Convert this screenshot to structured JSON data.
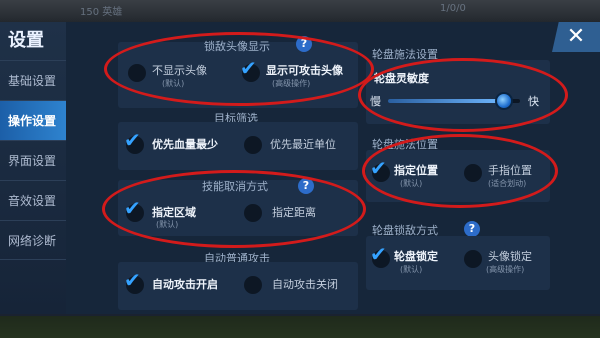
{
  "settings": {
    "title": "设置",
    "nav": [
      {
        "label": "基础设置",
        "active": false
      },
      {
        "label": "操作设置",
        "active": true
      },
      {
        "label": "界面设置",
        "active": false
      },
      {
        "label": "音效设置",
        "active": false
      },
      {
        "label": "网络诊断",
        "active": false
      }
    ],
    "close_icon": "close-icon"
  },
  "left": {
    "enemy_avatar": {
      "title": "锁敌头像显示",
      "opt1": {
        "label": "不显示头像",
        "sub": "(默认)",
        "checked": false
      },
      "opt2": {
        "label": "显示可攻击头像",
        "sub": "(高级操作)",
        "checked": true
      }
    },
    "target": {
      "title": "目标筛选",
      "opt1": {
        "label": "优先血量最少",
        "checked": true
      },
      "opt2": {
        "label": "优先最近单位",
        "checked": false
      }
    },
    "skill_cancel": {
      "title": "技能取消方式",
      "opt1": {
        "label": "指定区域",
        "sub": "(默认)",
        "checked": true
      },
      "opt2": {
        "label": "指定距离",
        "checked": false
      }
    },
    "auto_attack": {
      "title": "自动普通攻击",
      "opt1": {
        "label": "自动攻击开启",
        "checked": true
      },
      "opt2": {
        "label": "自动攻击关闭",
        "checked": false
      }
    }
  },
  "right": {
    "wheel": {
      "title": "轮盘施法设置",
      "sensitivity_label": "轮盘灵敏度",
      "slow": "慢",
      "fast": "快",
      "value": 0.88
    },
    "wheel_pos": {
      "title": "轮盘施法位置",
      "opt1": {
        "label": "指定位置",
        "sub": "(默认)",
        "checked": true
      },
      "opt2": {
        "label": "手指位置",
        "sub": "(适合划动)",
        "checked": false
      }
    },
    "lock": {
      "title": "轮盘锁敌方式",
      "opt1": {
        "label": "轮盘锁定",
        "sub": "(默认)",
        "checked": true
      },
      "opt2": {
        "label": "头像锁定",
        "sub": "(高级操作)",
        "checked": false
      }
    }
  },
  "hud": {
    "top_left": "150 英雄",
    "top_right": "1/0/0"
  },
  "colors": {
    "accent": "#2e83cf",
    "check": "#35a2ff",
    "annotation": "#d31b1b"
  }
}
